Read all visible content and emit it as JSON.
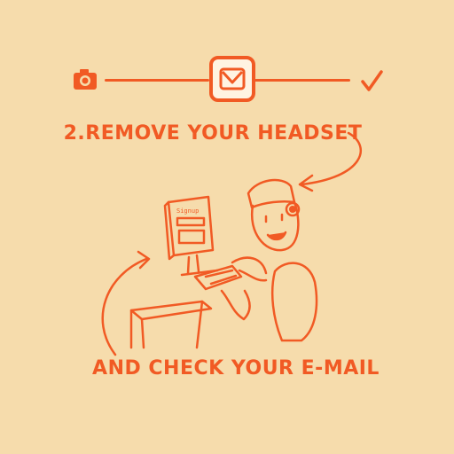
{
  "progress": {
    "steps": [
      {
        "icon": "camera-icon"
      },
      {
        "icon": "mail-icon",
        "active": true
      },
      {
        "icon": "checkmark-icon"
      }
    ]
  },
  "instructions": {
    "step_title": "2.REMOVE YOUR HEADSET",
    "step_subtitle": "AND CHECK YOUR E-MAIL"
  },
  "illustration": {
    "screen_text": "Signup",
    "icon": "person-at-computer-illustration"
  },
  "colors": {
    "background": "#f6dcac",
    "accent": "#f15a24"
  }
}
